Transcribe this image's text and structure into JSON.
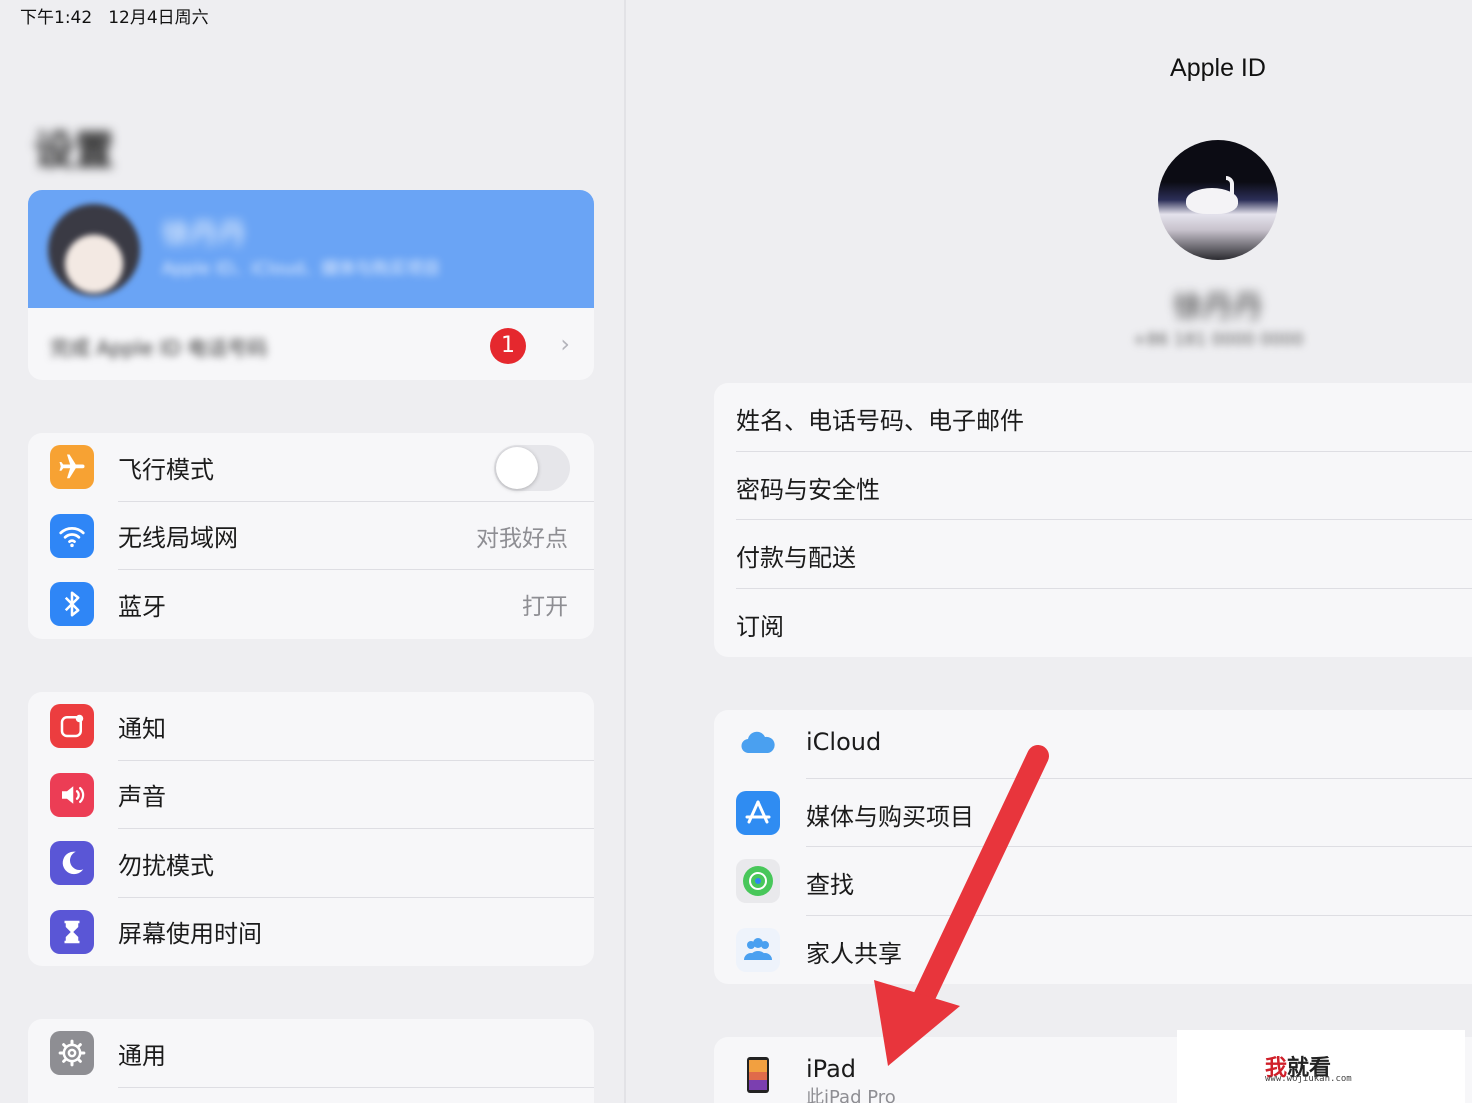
{
  "status_bar": {
    "time": "下午1:42",
    "date": "12月4日周六"
  },
  "sidebar": {
    "title": "设置",
    "profile": {
      "name": "徐丹丹",
      "subtitle": "Apple ID、iCloud、媒体与购买项目"
    },
    "suggestion": {
      "text": "完成 Apple ID 电话号码",
      "badge": "1"
    },
    "group1": [
      {
        "icon": "airplane-icon",
        "label": "飞行模式",
        "toggle": false,
        "color": "#f7a233"
      },
      {
        "icon": "wifi-icon",
        "label": "无线局域网",
        "value": "对我好点",
        "color": "#2f86f6"
      },
      {
        "icon": "bluetooth-icon",
        "label": "蓝牙",
        "value": "打开",
        "color": "#2f86f6"
      }
    ],
    "group2": [
      {
        "icon": "notification-icon",
        "label": "通知",
        "color": "#ec3d3f"
      },
      {
        "icon": "sound-icon",
        "label": "声音",
        "color": "#ec3d55"
      },
      {
        "icon": "moon-icon",
        "label": "勿扰模式",
        "color": "#5a56d6"
      },
      {
        "icon": "hourglass-icon",
        "label": "屏幕使用时间",
        "color": "#5a56d6"
      }
    ],
    "group3": [
      {
        "icon": "gear-icon",
        "label": "通用",
        "color": "#8e8e93"
      }
    ]
  },
  "detail": {
    "title": "Apple ID",
    "name": "徐丹丹",
    "email": "+86 181 0000 0000",
    "group1": [
      {
        "label": "姓名、电话号码、电子邮件"
      },
      {
        "label": "密码与安全性"
      },
      {
        "label": "付款与配送"
      },
      {
        "label": "订阅"
      }
    ],
    "group2": [
      {
        "icon": "icloud-icon",
        "label": "iCloud"
      },
      {
        "icon": "app-store-icon",
        "label": "媒体与购买项目"
      },
      {
        "icon": "find-my-icon",
        "label": "查找"
      },
      {
        "icon": "family-sharing-icon",
        "label": "家人共享"
      }
    ],
    "device": {
      "icon": "ipad-icon",
      "label": "iPad",
      "subtitle": "此iPad Pro"
    }
  },
  "annotation": {
    "arrow_color": "#e8353c"
  },
  "watermark": {
    "main_a": "我",
    "main_b": "就看",
    "sub": "www.wojiukan.com"
  }
}
